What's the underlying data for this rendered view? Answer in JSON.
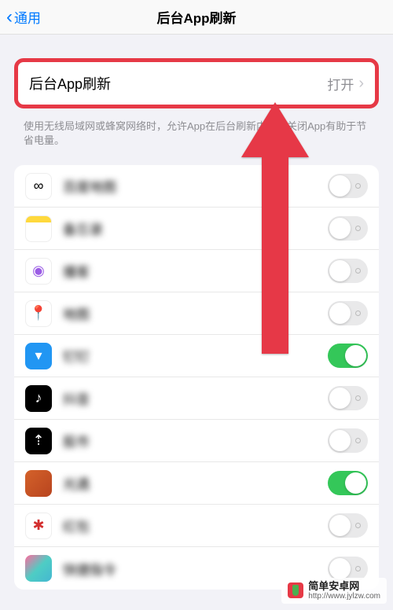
{
  "nav": {
    "back": "通用",
    "title": "后台App刷新"
  },
  "main": {
    "label": "后台App刷新",
    "value": "打开"
  },
  "footer": "使用无线局域网或蜂窝网络时，允许App在后台刷新内容。关闭App有助于节省电量。",
  "apps": [
    {
      "name": "百度地图",
      "on": false,
      "icon": "ic-baidu",
      "glyph": "∞"
    },
    {
      "name": "备忘录",
      "on": false,
      "icon": "ic-notes",
      "glyph": ""
    },
    {
      "name": "播客",
      "on": false,
      "icon": "ic-podcast",
      "glyph": "◉"
    },
    {
      "name": "地图",
      "on": false,
      "icon": "ic-maps",
      "glyph": "📍"
    },
    {
      "name": "钉钉",
      "on": true,
      "icon": "ic-blue",
      "glyph": "▾"
    },
    {
      "name": "抖音",
      "on": false,
      "icon": "ic-tiktok",
      "glyph": "♪"
    },
    {
      "name": "股市",
      "on": false,
      "icon": "ic-stocks",
      "glyph": "⇡"
    },
    {
      "name": "光遇",
      "on": true,
      "icon": "ic-game",
      "glyph": ""
    },
    {
      "name": "红包",
      "on": false,
      "icon": "ic-red",
      "glyph": "✱"
    },
    {
      "name": "快捷指令",
      "on": false,
      "icon": "ic-shortcuts",
      "glyph": ""
    }
  ],
  "watermark": {
    "line1": "简单安卓网",
    "line2": "http://www.jylzw.com"
  }
}
